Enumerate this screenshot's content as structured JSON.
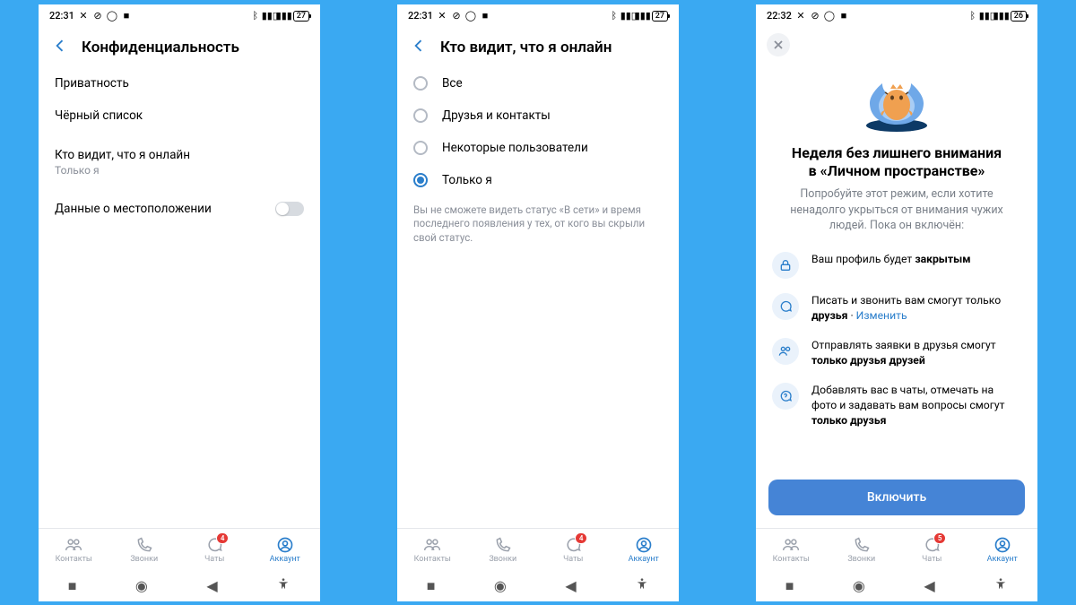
{
  "screens": {
    "s1": {
      "status": {
        "time": "22:31",
        "battery": "27"
      },
      "header": "Конфиденциальность",
      "rows": {
        "privacy": "Приватность",
        "blacklist": "Чёрный список",
        "online": {
          "label": "Кто видит, что я онлайн",
          "sub": "Только я"
        },
        "location": "Данные о местоположении"
      }
    },
    "s2": {
      "status": {
        "time": "22:31",
        "battery": "27"
      },
      "header": "Кто видит, что я онлайн",
      "options": {
        "all": "Все",
        "friends": "Друзья и контакты",
        "some": "Некоторые пользователи",
        "me": "Только я"
      },
      "hint": "Вы не сможете видеть статус «В сети» и время последнего появления у тех, от кого вы скрыли свой статус."
    },
    "s3": {
      "status": {
        "time": "22:32",
        "battery": "26"
      },
      "title1": "Неделя без лишнего внимания",
      "title2": "в «Личном пространстве»",
      "sub": "Попробуйте этот режим, если хотите ненадолго укрыться от внимания чужих людей. Пока он включён:",
      "feat1a": "Ваш профиль будет ",
      "feat1b": "закрытым",
      "feat2a": "Писать и звонить вам смогут только ",
      "feat2b": "друзья",
      "feat2dot": " · ",
      "feat2link": "Изменить",
      "feat3a": "Отправлять заявки в друзья смогут ",
      "feat3b": "только друзья друзей",
      "feat4a": "Добавлять вас в чаты, отмечать на фото и задавать вам вопросы смогут ",
      "feat4b": "только друзья",
      "cta": "Включить"
    }
  },
  "tabs": {
    "contacts": "Контакты",
    "calls": "Звонки",
    "chats": "Чаты",
    "account": "Аккаунт"
  },
  "badges": {
    "s1": "4",
    "s2": "4",
    "s3": "5"
  }
}
